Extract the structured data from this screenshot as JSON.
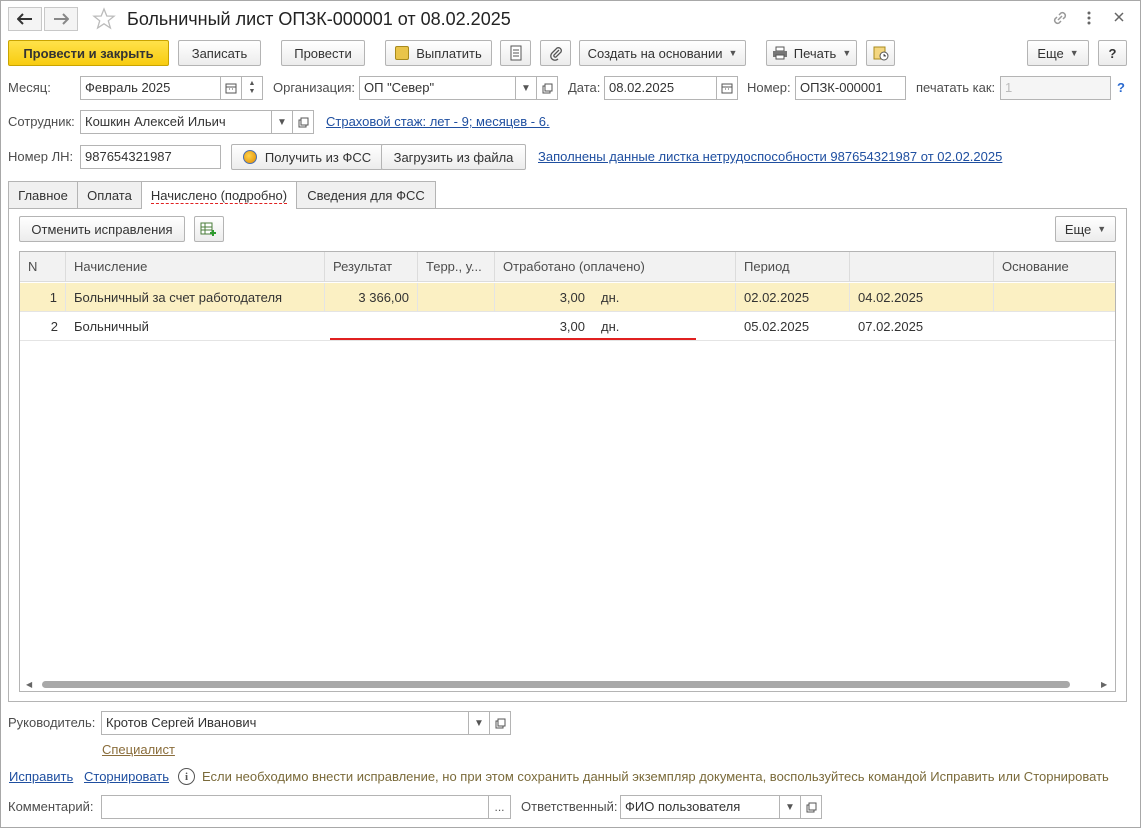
{
  "title": "Больничный лист ОПЗК-000001 от 08.02.2025",
  "toolbar": {
    "post_close": "Провести и закрыть",
    "save": "Записать",
    "post": "Провести",
    "pay": "Выплатить",
    "create_based": "Создать на основании",
    "print": "Печать",
    "more": "Еще",
    "help": "?"
  },
  "form": {
    "month_label": "Месяц:",
    "month_value": "Февраль 2025",
    "org_label": "Организация:",
    "org_value": "ОП \"Север\"",
    "date_label": "Дата:",
    "date_value": "08.02.2025",
    "number_label": "Номер:",
    "number_value": "ОПЗК-000001",
    "print_as_label": "печатать как:",
    "print_as_value": "1",
    "help_q": "?",
    "employee_label": "Сотрудник:",
    "employee_value": "Кошкин Алексей Ильич",
    "insurance_link": "Страховой стаж: лет - 9; месяцев - 6.",
    "ln_label": "Номер ЛН:",
    "ln_value": "987654321987",
    "get_fss": "Получить из ФСС",
    "load_file": "Загрузить из файла",
    "ln_filled_link": "Заполнены данные листка нетрудоспособности 987654321987 от 02.02.2025"
  },
  "tabs": [
    "Главное",
    "Оплата",
    "Начислено (подробно)",
    "Сведения для ФСС"
  ],
  "panel": {
    "cancel_corrections": "Отменить исправления",
    "more": "Еще"
  },
  "table": {
    "columns": [
      "N",
      "Начисление",
      "Результат",
      "Терр., у...",
      "Отработано (оплачено)",
      "Период",
      "",
      "Основание"
    ],
    "rows": [
      {
        "n": "1",
        "name": "Больничный за счет работодателя",
        "result": "3 366,00",
        "terr": "",
        "worked": "3,00",
        "unit": "дн.",
        "from": "02.02.2025",
        "to": "04.02.2025",
        "basis": ""
      },
      {
        "n": "2",
        "name": "Больничный",
        "result": "",
        "terr": "",
        "worked": "3,00",
        "unit": "дн.",
        "from": "05.02.2025",
        "to": "07.02.2025",
        "basis": ""
      }
    ]
  },
  "footer": {
    "head_label": "Руководитель:",
    "head_value": "Кротов Сергей Иванович",
    "specialist_link": "Специалист",
    "fix_link": "Исправить",
    "storno_link": "Сторнировать",
    "info_text": "Если необходимо внести исправление, но при этом сохранить данный экземпляр документа, воспользуйтесь командой Исправить или Сторнировать",
    "comment_label": "Комментарий:",
    "comment_value": "",
    "comment_btn": "...",
    "responsible_label": "Ответственный:",
    "responsible_value": "ФИО пользователя"
  },
  "colors": {
    "accent_yellow": "#f8cc10",
    "selected_row": "#fbf0c3",
    "link_blue": "#1f4fa0",
    "red_underline": "#e02020"
  }
}
